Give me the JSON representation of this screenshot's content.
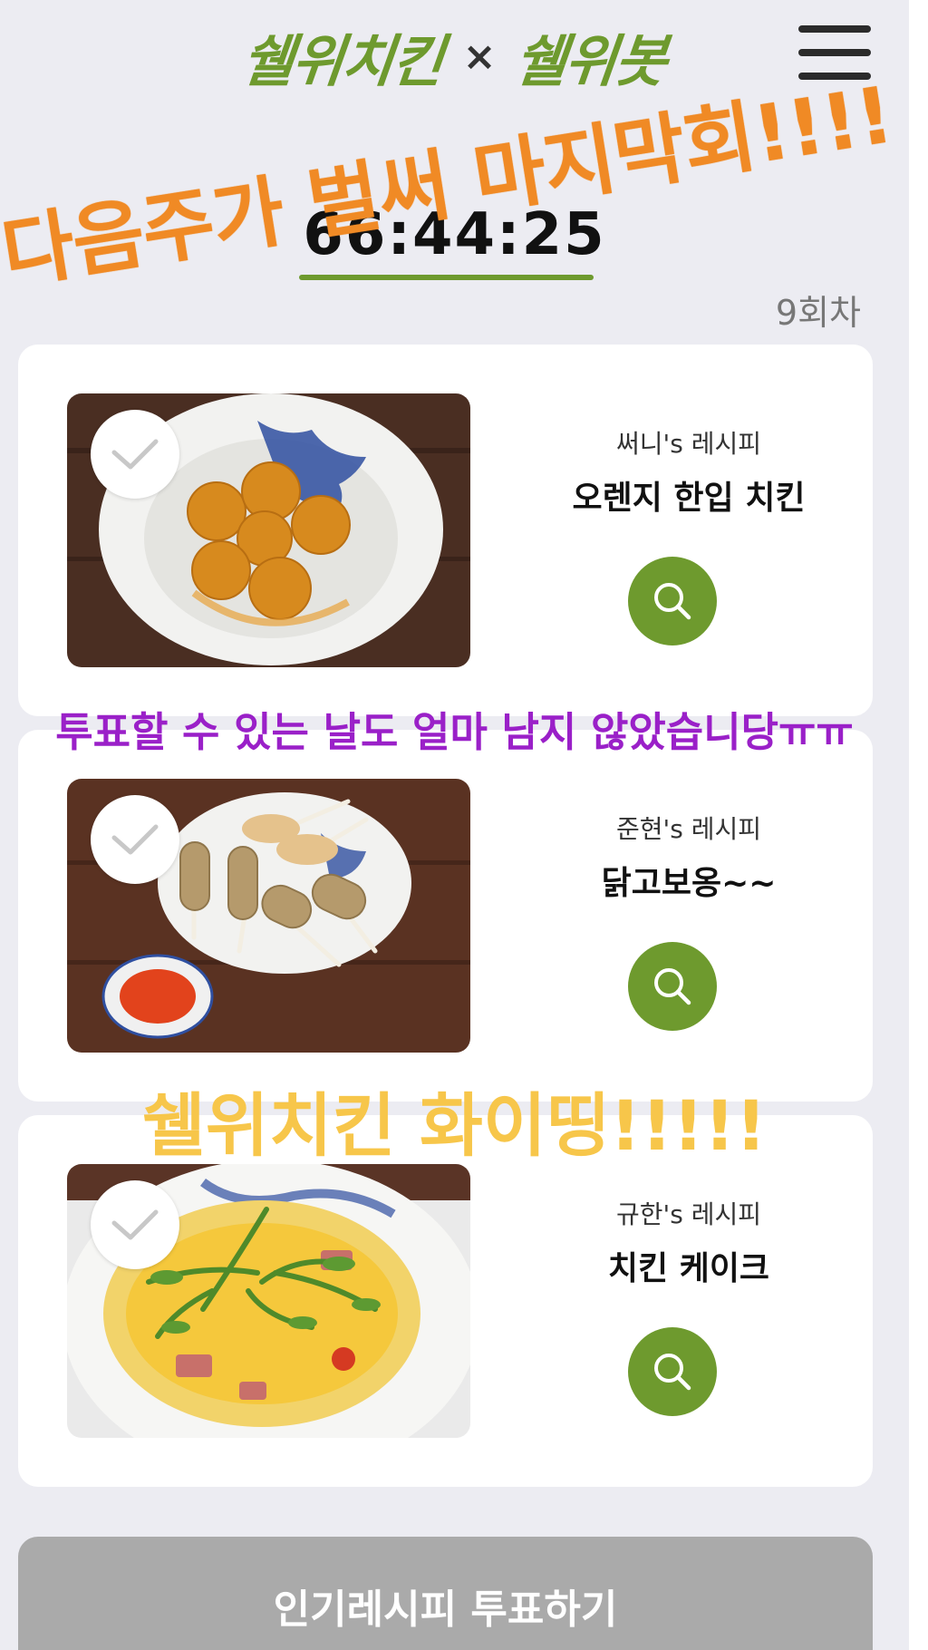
{
  "header": {
    "logo_left": "쉘위치킨",
    "logo_separator": "×",
    "logo_right": "쉘위봇",
    "menu_icon": "hamburger-menu-icon"
  },
  "timer": {
    "value": "66:44:25",
    "round": "9회차"
  },
  "recipes": [
    {
      "author": "써니's 레시피",
      "title": "오렌지 한입 치킨",
      "selected": false
    },
    {
      "author": "준현's 레시피",
      "title": "닭고보옹~~",
      "selected": false
    },
    {
      "author": "규한's 레시피",
      "title": "치킨 케이크",
      "selected": false
    }
  ],
  "vote_button": {
    "label": "인기레시피 투표하기"
  },
  "overlays": {
    "caption_orange": "다음주가 벌써 마지막회!!!!",
    "caption_purple": "투표할 수 있는 날도 얼마 남지 않았습니당ㅠㅠ",
    "caption_yellow": "쉘위치킨 화이띵!!!!!"
  },
  "colors": {
    "brand_green": "#6e9a2e",
    "page_bg": "#ececf2",
    "vote_button_bg": "#aaaaaa",
    "caption_orange": "#f08a25",
    "caption_purple": "#9a20c8",
    "caption_yellow": "#f7c64a"
  }
}
